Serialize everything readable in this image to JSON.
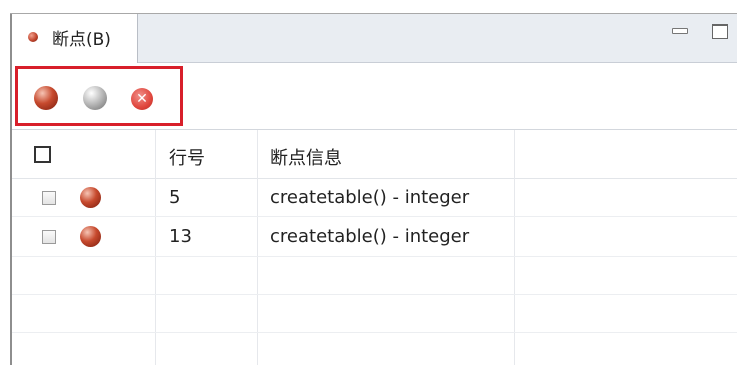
{
  "tab": {
    "label": "断点(B)",
    "icon": "breakpoint-dot-icon"
  },
  "window_buttons": {
    "minimize_icon": "minimize-icon",
    "maximize_icon": "maximize-icon"
  },
  "toolbar": {
    "buttons": [
      {
        "icon": "breakpoint-enabled-icon",
        "color": "#c74a2e"
      },
      {
        "icon": "breakpoint-disabled-icon",
        "color": "#bdbdbd"
      },
      {
        "icon": "remove-breakpoint-icon",
        "color": "#e0463d"
      }
    ],
    "highlight_color": "#d81f2a"
  },
  "table": {
    "columns": [
      "",
      "行号",
      "断点信息"
    ],
    "rows": [
      {
        "checked": false,
        "line": "5",
        "info": "createtable() - integer"
      },
      {
        "checked": false,
        "line": "13",
        "info": "createtable() - integer"
      }
    ]
  }
}
